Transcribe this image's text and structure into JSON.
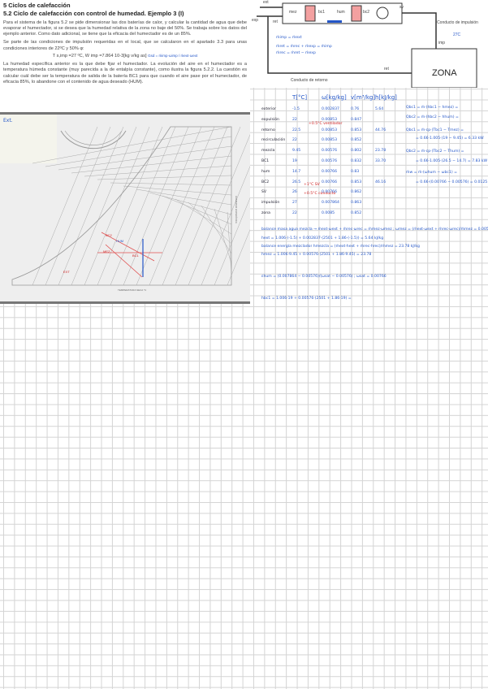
{
  "doc": {
    "section": "5 Ciclos de calefacción",
    "title": "5.2 Ciclo de calefacción con control de humedad. Ejemplo 3 (I)",
    "p1": "Para el sistema de la figura 5.2 se pide dimensionar las dos baterías de calor, y calcular la cantidad de agua que debe evaporar el humectador, si se desea que la humedad relativa de la zona no baje del 50%. Se trabaja sobre los datos del ejemplo anterior. Como dato adicional, se tiene que la eficacia del humectador es de un 85%.",
    "p2": "Se parte de las condiciones de impulsión requeridas en el local, que se calcularon en el apartado 3.3 para unas condiciones interiores de 22ºC y 50% φ:",
    "formula": "T s,imp =27 ºC, W imp =7.864 10-3[kg v/kg as]",
    "note": "Gsd = ṁimp·ωimp / ṁext·ωext",
    "p3": "La humedad específica anterior es la que debe fijar el humectador. La evolución del aire en el humectador es a temperatura húmeda constante (muy parecida a la de entalpía constante), como ilustra la figura 5.2.2. La cuestión es calcular cuál debe ser la temperatura de salida de la batería BC1 para que cuando el aire pase por el humectador, de eficacia 85%, lo abandone con el contenido de agua deseado (HUM)."
  },
  "chart": {
    "note": "Ext.",
    "xlabel": "TEMPERATURA SECA °C",
    "ylabel": "HUMEDAD ESPECÍFICA",
    "points": [
      "BC2",
      "HUM",
      "BC1",
      "MEZ",
      "EXT"
    ]
  },
  "diagram": {
    "ext": "ext",
    "exp": "exp",
    "ret": "ret",
    "mez": "mez",
    "bc1": "bc1",
    "hum": "hum",
    "bc2": "bc2",
    "sv": "sv",
    "imp": "imp",
    "ret2": "ret",
    "conducto_imp": "Conducto de impulsión",
    "imp_t": "27C",
    "zona": "ZONA",
    "conducto_ret": "Conducto de retorno",
    "notes": [
      "ṁimp = ṁext",
      "ṁret = ṁrec + ṁexp = ṁimp",
      "ṁrec = ṁret − ṁexp"
    ]
  },
  "table": {
    "headers": [
      "T[°C]",
      "ω[kg/kg]",
      "v[m³/kg]",
      "h[kJ/kg]"
    ],
    "rows": [
      {
        "name": "exterior",
        "T": "-1.5",
        "w": "0.002837",
        "v": "0.76",
        "h": "5.64"
      },
      {
        "name": "expulsión",
        "T": "22",
        "w": "0.00853",
        "v": "0.847",
        "h": ""
      },
      {
        "name": "retorno",
        "T": "22.5",
        "w": "0.00853",
        "v": "0.853",
        "h": "44.76"
      },
      {
        "name": "recirculación",
        "T": "22",
        "w": "0.00853",
        "v": "0.852",
        "h": ""
      },
      {
        "name": "mezcla",
        "T": "9.45",
        "w": "0.00576",
        "v": "0.802",
        "h": "23.78"
      },
      {
        "name": "BC1",
        "T": "19",
        "w": "0.00576",
        "v": "0.832",
        "h": "33.70"
      },
      {
        "name": "hum",
        "T": "14.7",
        "w": "0.00766",
        "v": "0.83",
        "h": ""
      },
      {
        "name": "BC2",
        "T": "26.5",
        "w": "0.00766",
        "v": "0.853",
        "h": "46.16"
      },
      {
        "name": "SV",
        "T": "26",
        "w": "0.00766",
        "v": "0.862",
        "h": ""
      },
      {
        "name": "impulsión",
        "T": "27",
        "w": "0.007864",
        "v": "0.863",
        "h": ""
      },
      {
        "name": "zona",
        "T": "22",
        "w": "0.0085",
        "v": "0.852",
        "h": ""
      }
    ],
    "red_notes": [
      "+0.5°C ventilador",
      "+1°C SV",
      "+0.5°C conducto"
    ],
    "right": [
      "Qbc1 = ṁ·(hbc1 − hmez) =",
      "Qbc2 = ṁ·(hbc2 − hhum) =",
      "Qbc1 = ṁ·cp·(Tbc1 − Tmez) =",
      "= 0.66·1.005·(19 − 9.45) = 6.33 kW",
      "Qbc2 = ṁ·cp·(Tbc2 − Thum) =",
      "= 0.66·1.005·(26.5 − 14.7) = 7.83 kW",
      "ṁw = ṁ·(ωhum − ωbc1) =",
      "= 0.66·(0.00766 − 0.00576) = 0.0125 kg/s"
    ]
  },
  "calc": [
    "balance masa agua mezcla → ṁext·ωext + ṁrec·ωrec = ṁmez·ωmez ; ωmez = (ṁext·ωext + ṁrec·ωrec)/ṁmez = 0.00576",
    "hext = 1.006·(-1.5) + 0.002837·(2501 + 1.86·(-1.5)) = 5.64 kJ/kg",
    "balance energía mezclador  hmezcla = (ṁext·hext + ṁrec·hrec)/ṁmez = 23.78 kJ/kg",
    "hmez = 1.006·9.45 + 0.00576·(2501 + 1.86·9.45) = 23.78",
    "εhum = (0.007864 − 0.00576)/(ωsat − 0.00576) ; ωsat = 0.00766",
    "hbc1 = 1.006·19 + 0.00576·(2501 + 1.86·19) ="
  ]
}
